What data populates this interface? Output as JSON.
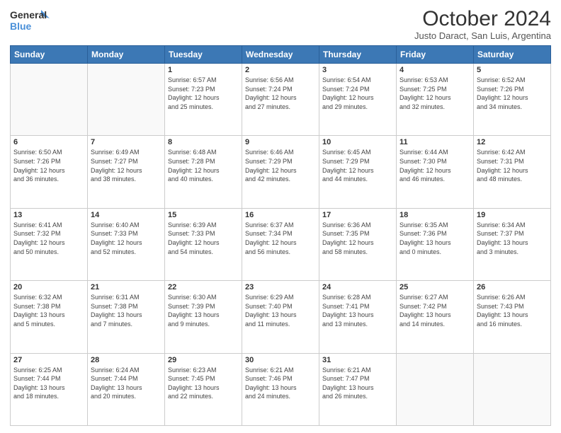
{
  "logo": {
    "line1": "General",
    "line2": "Blue"
  },
  "title": "October 2024",
  "subtitle": "Justo Daract, San Luis, Argentina",
  "headers": [
    "Sunday",
    "Monday",
    "Tuesday",
    "Wednesday",
    "Thursday",
    "Friday",
    "Saturday"
  ],
  "weeks": [
    [
      {
        "day": "",
        "info": ""
      },
      {
        "day": "",
        "info": ""
      },
      {
        "day": "1",
        "info": "Sunrise: 6:57 AM\nSunset: 7:23 PM\nDaylight: 12 hours\nand 25 minutes."
      },
      {
        "day": "2",
        "info": "Sunrise: 6:56 AM\nSunset: 7:24 PM\nDaylight: 12 hours\nand 27 minutes."
      },
      {
        "day": "3",
        "info": "Sunrise: 6:54 AM\nSunset: 7:24 PM\nDaylight: 12 hours\nand 29 minutes."
      },
      {
        "day": "4",
        "info": "Sunrise: 6:53 AM\nSunset: 7:25 PM\nDaylight: 12 hours\nand 32 minutes."
      },
      {
        "day": "5",
        "info": "Sunrise: 6:52 AM\nSunset: 7:26 PM\nDaylight: 12 hours\nand 34 minutes."
      }
    ],
    [
      {
        "day": "6",
        "info": "Sunrise: 6:50 AM\nSunset: 7:26 PM\nDaylight: 12 hours\nand 36 minutes."
      },
      {
        "day": "7",
        "info": "Sunrise: 6:49 AM\nSunset: 7:27 PM\nDaylight: 12 hours\nand 38 minutes."
      },
      {
        "day": "8",
        "info": "Sunrise: 6:48 AM\nSunset: 7:28 PM\nDaylight: 12 hours\nand 40 minutes."
      },
      {
        "day": "9",
        "info": "Sunrise: 6:46 AM\nSunset: 7:29 PM\nDaylight: 12 hours\nand 42 minutes."
      },
      {
        "day": "10",
        "info": "Sunrise: 6:45 AM\nSunset: 7:29 PM\nDaylight: 12 hours\nand 44 minutes."
      },
      {
        "day": "11",
        "info": "Sunrise: 6:44 AM\nSunset: 7:30 PM\nDaylight: 12 hours\nand 46 minutes."
      },
      {
        "day": "12",
        "info": "Sunrise: 6:42 AM\nSunset: 7:31 PM\nDaylight: 12 hours\nand 48 minutes."
      }
    ],
    [
      {
        "day": "13",
        "info": "Sunrise: 6:41 AM\nSunset: 7:32 PM\nDaylight: 12 hours\nand 50 minutes."
      },
      {
        "day": "14",
        "info": "Sunrise: 6:40 AM\nSunset: 7:33 PM\nDaylight: 12 hours\nand 52 minutes."
      },
      {
        "day": "15",
        "info": "Sunrise: 6:39 AM\nSunset: 7:33 PM\nDaylight: 12 hours\nand 54 minutes."
      },
      {
        "day": "16",
        "info": "Sunrise: 6:37 AM\nSunset: 7:34 PM\nDaylight: 12 hours\nand 56 minutes."
      },
      {
        "day": "17",
        "info": "Sunrise: 6:36 AM\nSunset: 7:35 PM\nDaylight: 12 hours\nand 58 minutes."
      },
      {
        "day": "18",
        "info": "Sunrise: 6:35 AM\nSunset: 7:36 PM\nDaylight: 13 hours\nand 0 minutes."
      },
      {
        "day": "19",
        "info": "Sunrise: 6:34 AM\nSunset: 7:37 PM\nDaylight: 13 hours\nand 3 minutes."
      }
    ],
    [
      {
        "day": "20",
        "info": "Sunrise: 6:32 AM\nSunset: 7:38 PM\nDaylight: 13 hours\nand 5 minutes."
      },
      {
        "day": "21",
        "info": "Sunrise: 6:31 AM\nSunset: 7:38 PM\nDaylight: 13 hours\nand 7 minutes."
      },
      {
        "day": "22",
        "info": "Sunrise: 6:30 AM\nSunset: 7:39 PM\nDaylight: 13 hours\nand 9 minutes."
      },
      {
        "day": "23",
        "info": "Sunrise: 6:29 AM\nSunset: 7:40 PM\nDaylight: 13 hours\nand 11 minutes."
      },
      {
        "day": "24",
        "info": "Sunrise: 6:28 AM\nSunset: 7:41 PM\nDaylight: 13 hours\nand 13 minutes."
      },
      {
        "day": "25",
        "info": "Sunrise: 6:27 AM\nSunset: 7:42 PM\nDaylight: 13 hours\nand 14 minutes."
      },
      {
        "day": "26",
        "info": "Sunrise: 6:26 AM\nSunset: 7:43 PM\nDaylight: 13 hours\nand 16 minutes."
      }
    ],
    [
      {
        "day": "27",
        "info": "Sunrise: 6:25 AM\nSunset: 7:44 PM\nDaylight: 13 hours\nand 18 minutes."
      },
      {
        "day": "28",
        "info": "Sunrise: 6:24 AM\nSunset: 7:44 PM\nDaylight: 13 hours\nand 20 minutes."
      },
      {
        "day": "29",
        "info": "Sunrise: 6:23 AM\nSunset: 7:45 PM\nDaylight: 13 hours\nand 22 minutes."
      },
      {
        "day": "30",
        "info": "Sunrise: 6:21 AM\nSunset: 7:46 PM\nDaylight: 13 hours\nand 24 minutes."
      },
      {
        "day": "31",
        "info": "Sunrise: 6:21 AM\nSunset: 7:47 PM\nDaylight: 13 hours\nand 26 minutes."
      },
      {
        "day": "",
        "info": ""
      },
      {
        "day": "",
        "info": ""
      }
    ]
  ],
  "colors": {
    "header_bg": "#3c78b5",
    "header_text": "#ffffff",
    "border": "#cccccc"
  }
}
